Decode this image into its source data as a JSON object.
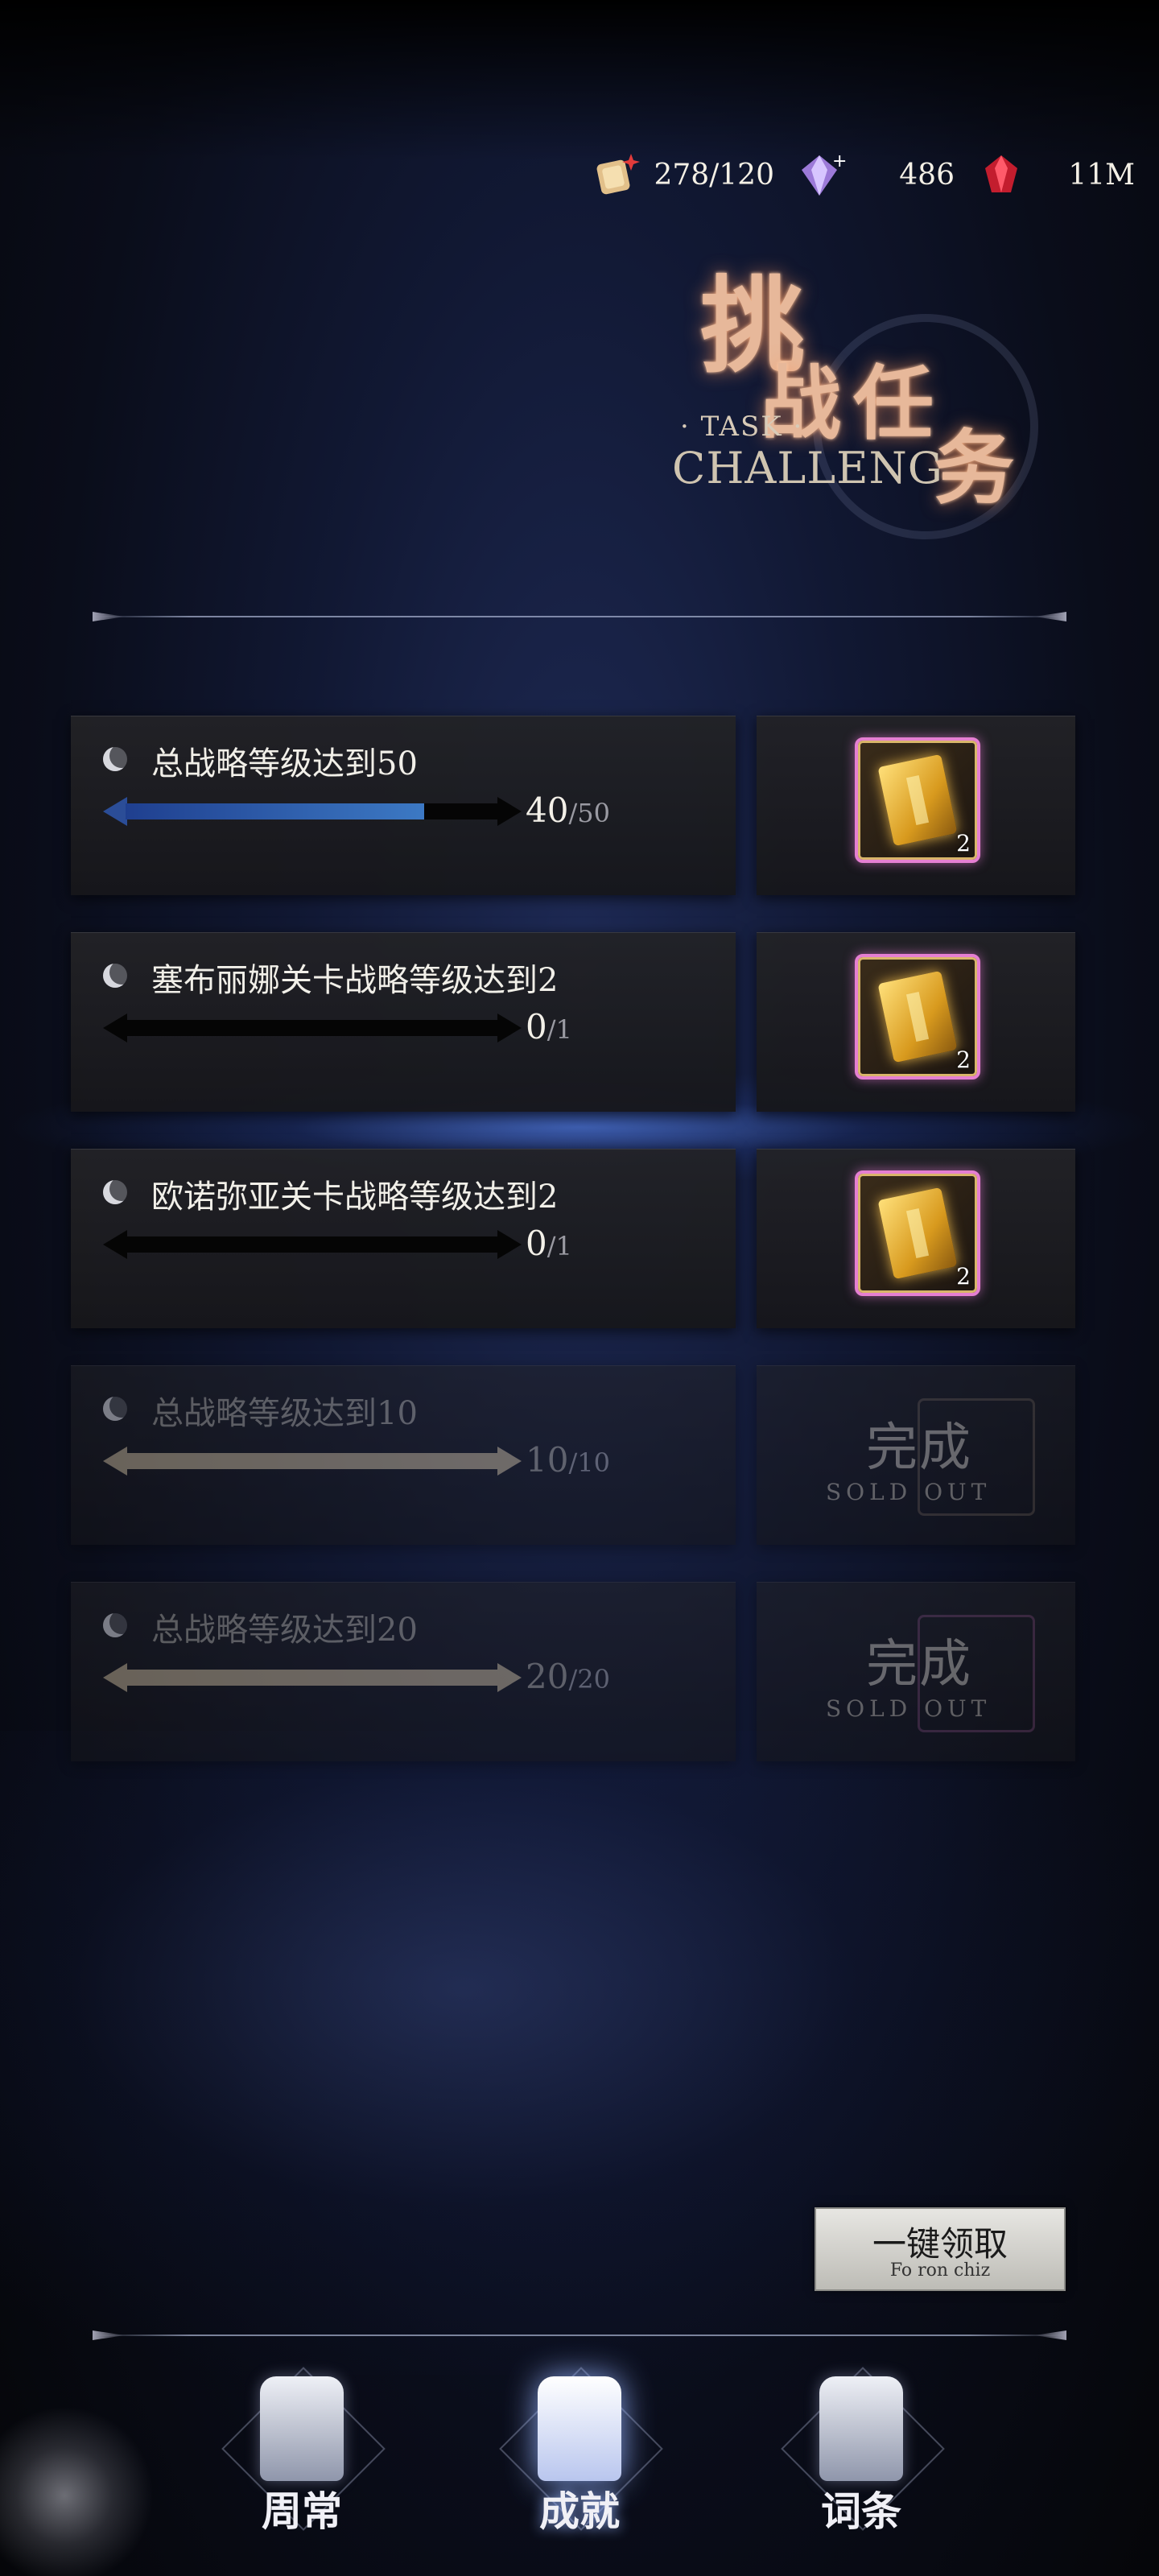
{
  "currency": [
    {
      "icon": "scroll-stamina-icon",
      "value": "278/120"
    },
    {
      "icon": "crystal-icon",
      "value": "486"
    },
    {
      "icon": "red-gem-icon",
      "value": "11M"
    }
  ],
  "title": {
    "cn_1": "挑",
    "cn_2": "战",
    "cn_3": "任",
    "cn_4": "务",
    "en_small": "· TASK ·",
    "en_large": "CHALLENG"
  },
  "tasks": [
    {
      "name": "总战略等级达到50",
      "current": "40",
      "total": "/50",
      "progress": 0.8,
      "reward_qty": "2",
      "state": "active"
    },
    {
      "name": "塞布丽娜关卡战略等级达到2",
      "current": "0",
      "total": "/1",
      "progress": 0,
      "reward_qty": "2",
      "state": "active"
    },
    {
      "name": "欧诺弥亚关卡战略等级达到2",
      "current": "0",
      "total": "/1",
      "progress": 0,
      "reward_qty": "2",
      "state": "active"
    },
    {
      "name": "总战略等级达到10",
      "current": "10",
      "total": "/10",
      "progress": 1,
      "state": "done",
      "done_cn": "完成",
      "done_en": "SOLD OUT"
    },
    {
      "name": "总战略等级达到20",
      "current": "20",
      "total": "/20",
      "progress": 1,
      "state": "done",
      "done_cn": "完成",
      "done_en": "SOLD OUT"
    }
  ],
  "claim_all": {
    "label": "一键领取",
    "sub": "Fo ron chiz"
  },
  "nav": [
    {
      "label": "周常",
      "icon": "quill-scroll-icon",
      "active": false
    },
    {
      "label": "成就",
      "icon": "star-scroll-icon",
      "active": true
    },
    {
      "label": "词条",
      "icon": "flame-scroll-icon",
      "active": false
    }
  ],
  "colors": {
    "progress_active": "#2e5fb0",
    "progress_done": "#b7a88c",
    "reward_border": "#e57fd2"
  }
}
